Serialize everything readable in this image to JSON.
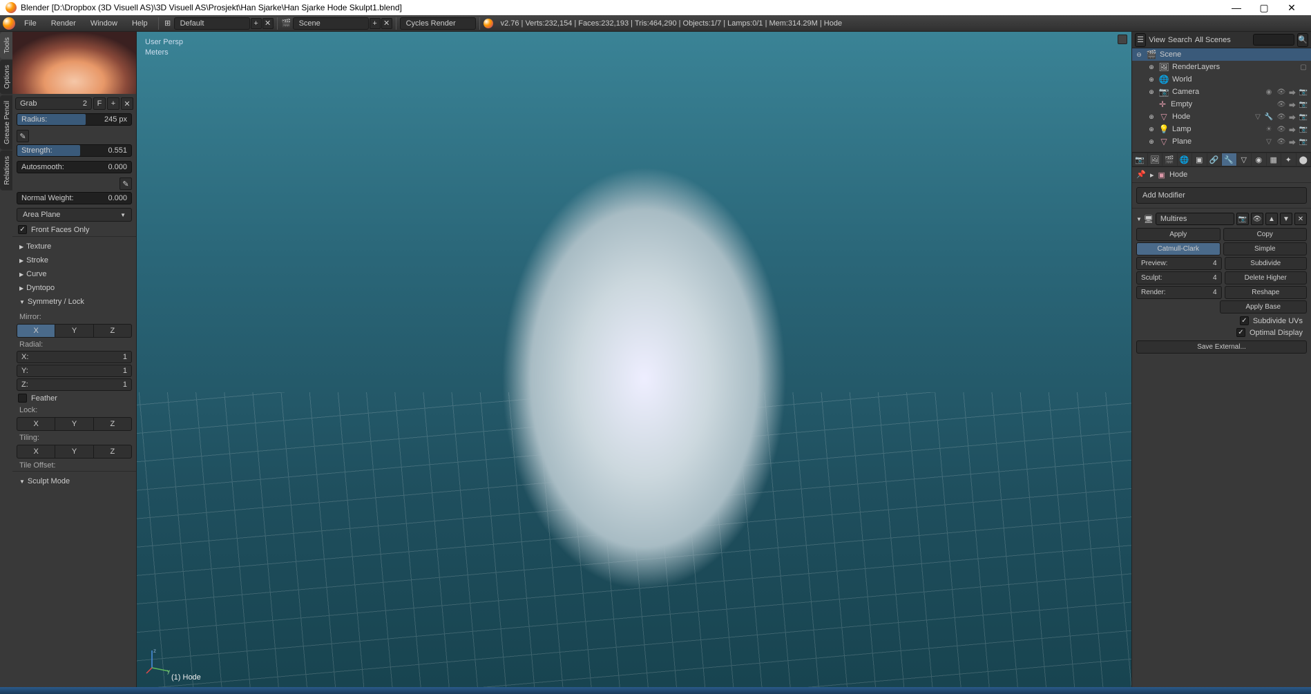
{
  "titlebar": {
    "app": "Blender",
    "file": "[D:\\Dropbox (3D Visuell AS)\\3D Visuell AS\\Prosjekt\\Han Sjarke\\Han Sjarke Hode Skulpt1.blend]",
    "full": "Blender [D:\\Dropbox (3D Visuell AS)\\3D Visuell AS\\Prosjekt\\Han Sjarke\\Han Sjarke Hode Skulpt1.blend]"
  },
  "menu": {
    "file": "File",
    "render": "Render",
    "window": "Window",
    "help": "Help"
  },
  "header": {
    "layout": "Default",
    "scene": "Scene",
    "engine": "Cycles Render",
    "stats": "v2.76 | Verts:232,154 | Faces:232,193 | Tris:464,290 | Objects:1/7 | Lamps:0/1 | Mem:314.29M | Hode"
  },
  "left_tabs": [
    "Tools",
    "Options",
    "Grease Pencil",
    "Relations"
  ],
  "brush": {
    "name": "Grab",
    "users": "2",
    "fake": "F"
  },
  "radius": {
    "label": "Radius:",
    "value": "245 px"
  },
  "strength": {
    "label": "Strength:",
    "value": "0.551",
    "fill": "55.1%"
  },
  "autosmooth": {
    "label": "Autosmooth:",
    "value": "0.000"
  },
  "normal_weight": {
    "label": "Normal Weight:",
    "value": "0.000"
  },
  "plane": "Area Plane",
  "front_faces": "Front Faces Only",
  "collapse": {
    "texture": "Texture",
    "stroke": "Stroke",
    "curve": "Curve",
    "dyntopo": "Dyntopo",
    "symmetry": "Symmetry / Lock",
    "sculpt_mode": "Sculpt Mode"
  },
  "mirror_label": "Mirror:",
  "radial_label": "Radial:",
  "radial": {
    "x": {
      "label": "X:",
      "val": "1"
    },
    "y": {
      "label": "Y:",
      "val": "1"
    },
    "z": {
      "label": "Z:",
      "val": "1"
    }
  },
  "feather": "Feather",
  "lock_label": "Lock:",
  "tiling_label": "Tiling:",
  "tile_offset": "Tile Offset:",
  "axes": {
    "x": "X",
    "y": "Y",
    "z": "Z"
  },
  "viewport": {
    "persp": "User Persp",
    "units": "Meters",
    "bottom": "(1) Hode"
  },
  "right_header": {
    "view": "View",
    "search": "Search",
    "all_scenes": "All Scenes"
  },
  "outliner": {
    "scene": "Scene",
    "render_layers": "RenderLayers",
    "world": "World",
    "camera": "Camera",
    "empty": "Empty",
    "hode": "Hode",
    "lamp": "Lamp",
    "plane": "Plane"
  },
  "breadcrumb": {
    "obj": "Hode"
  },
  "add_modifier": "Add Modifier",
  "multires": {
    "name": "Multires",
    "apply": "Apply",
    "copy": "Copy",
    "catmull": "Catmull-Clark",
    "simple": "Simple",
    "preview": {
      "label": "Preview:",
      "val": "4"
    },
    "sculpt": {
      "label": "Sculpt:",
      "val": "4"
    },
    "render": {
      "label": "Render:",
      "val": "4"
    },
    "subdivide": "Subdivide",
    "delete_higher": "Delete Higher",
    "reshape": "Reshape",
    "apply_base": "Apply Base",
    "subdivide_uvs": "Subdivide UVs",
    "optimal_display": "Optimal Display",
    "save_external": "Save External..."
  }
}
